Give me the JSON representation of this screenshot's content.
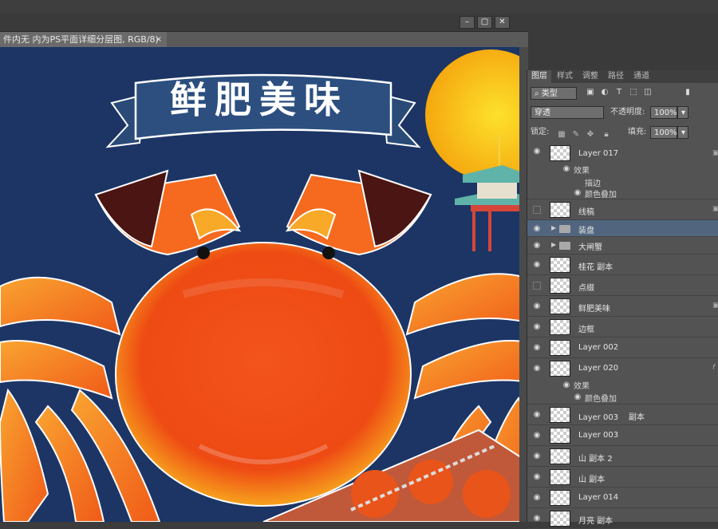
{
  "document": {
    "tab_title": "件内无  内为PS平面详细分层图, RGB/8)",
    "tab_close": "×"
  },
  "window_controls": [
    "–",
    "▢",
    "✕"
  ],
  "canvas": {
    "banner_text": "鲜肥美味",
    "colors": {
      "background": "#1c3565",
      "crab": "#f0571a",
      "moon": "#f7b614"
    }
  },
  "layers_panel": {
    "tabs": [
      "图层",
      "样式",
      "调整",
      "路径",
      "通道"
    ],
    "active_tab": "图层",
    "filter_kind": "类型",
    "blend_mode": "穿透",
    "opacity_label": "不透明度:",
    "opacity_value": "100%",
    "lock_label": "锁定:",
    "fill_label": "填充:",
    "fill_value": "100%",
    "layers": [
      {
        "name": "Layer 017",
        "visible": true,
        "locked": true,
        "fx": true,
        "sub": [
          "效果",
          "描边",
          "颜色叠加"
        ]
      },
      {
        "name": "线稿",
        "visible": false,
        "locked": true
      },
      {
        "name": "装盘",
        "visible": true,
        "group": true,
        "selected": true
      },
      {
        "name": "大闸蟹",
        "visible": true,
        "group": true
      },
      {
        "name": "桂花 副本",
        "visible": true
      },
      {
        "name": "点缀",
        "visible": false
      },
      {
        "name": "鲜肥美味",
        "visible": true,
        "locked": true
      },
      {
        "name": "边框",
        "visible": true
      },
      {
        "name": "Layer 002",
        "visible": true
      },
      {
        "name": "Layer 020",
        "visible": true,
        "fx": true,
        "sub": [
          "效果",
          "颜色叠加"
        ]
      },
      {
        "name": "Layer 003    副本",
        "visible": true
      },
      {
        "name": "Layer 003",
        "visible": true
      },
      {
        "name": "山 副本 2",
        "visible": true
      },
      {
        "name": "山 副本",
        "visible": true
      },
      {
        "name": "Layer 014",
        "visible": true
      },
      {
        "name": "月亮 副本",
        "visible": true
      }
    ]
  }
}
